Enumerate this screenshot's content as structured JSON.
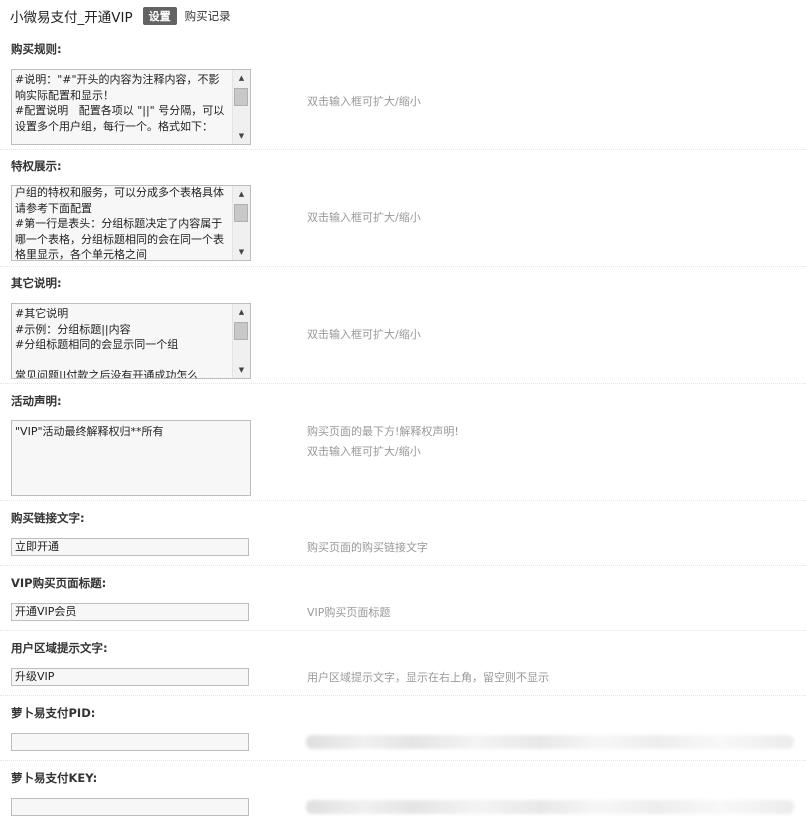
{
  "header": {
    "title": "小微易支付_开通VIP",
    "tab_active": "设置",
    "tab_link": "购买记录"
  },
  "sections": {
    "rules": {
      "label": "购买规则:",
      "text": "#说明：\"#\"开头的内容为注释内容，不影响实际配置和显示！\n#配置说明   配置各项以 \"||\" 号分隔，可以设置多个用户组，每行一个。格式如下：",
      "hint": "双击输入框可扩大/缩小"
    },
    "privilege": {
      "label": "特权展示:",
      "text": "户组的特权和服务，可以分成多个表格具体请参考下面配置\n#第一行是表头：分组标题决定了内容属于哪一个表格，分组标题相同的会在同一个表格里显示，各个单元格之间",
      "hint": "双击输入框可扩大/缩小"
    },
    "other": {
      "label": "其它说明:",
      "text": "#其它说明\n#示例：分组标题||内容\n#分组标题相同的会显示同一个组\n\n常见问题||付款之后没有开通成功怎么",
      "hint": "双击输入框可扩大/缩小"
    },
    "activity": {
      "label": "活动声明:",
      "text": "\"VIP\"活动最终解释权归**所有",
      "hint_1": "购买页面的最下方!解释权声明!",
      "hint_2": "双击输入框可扩大/缩小"
    },
    "buy_link": {
      "label": "购买链接文字:",
      "value": "立即开通",
      "hint": "购买页面的购买链接文字"
    },
    "vip_title": {
      "label": "VIP购买页面标题:",
      "value": "开通VIP会员",
      "hint": "VIP购买页面标题"
    },
    "user_hint": {
      "label": "用户区域提示文字:",
      "value": "升级VIP",
      "hint": "用户区域提示文字，显示在右上角，留空则不显示"
    },
    "pid": {
      "label": "萝卜易支付PID:",
      "value": ""
    },
    "key": {
      "label": "萝卜易支付KEY:",
      "value": ""
    }
  },
  "icons": {
    "scroll_up": "▲",
    "scroll_down": "▼"
  }
}
